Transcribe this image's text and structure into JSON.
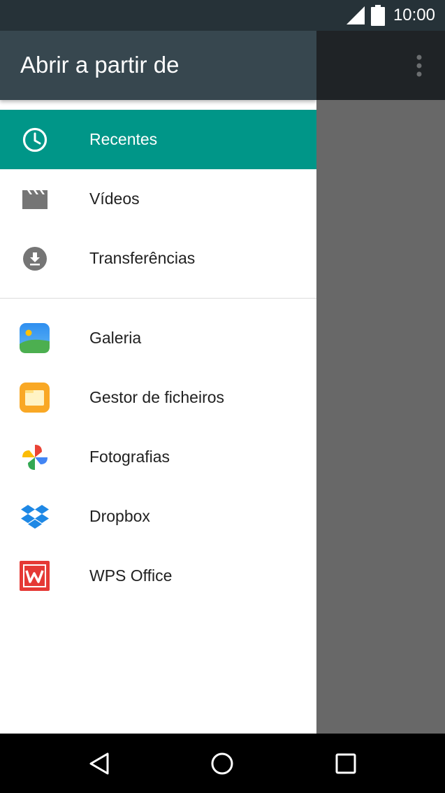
{
  "status_bar": {
    "time": "10:00",
    "icons": [
      "signal-icon",
      "battery-icon"
    ]
  },
  "drawer": {
    "title": "Abrir a partir de",
    "roots": [
      {
        "label": "Recentes",
        "icon": "clock-icon",
        "selected": true
      },
      {
        "label": "Vídeos",
        "icon": "video-icon",
        "selected": false
      },
      {
        "label": "Transferências",
        "icon": "download-icon",
        "selected": false
      }
    ],
    "apps": [
      {
        "label": "Galeria",
        "icon": "gallery-icon"
      },
      {
        "label": "Gestor de ficheiros",
        "icon": "file-manager-icon"
      },
      {
        "label": "Fotografias",
        "icon": "photos-pinwheel-icon"
      },
      {
        "label": "Dropbox",
        "icon": "dropbox-icon"
      },
      {
        "label": "WPS Office",
        "icon": "wps-office-icon"
      }
    ]
  },
  "toolbar": {
    "overflow_icon": "more-vert-icon"
  },
  "nav_bar": {
    "icons": [
      "back-icon",
      "home-icon",
      "recents-icon"
    ]
  },
  "colors": {
    "status_bar": "#263238",
    "drawer_header": "#37474f",
    "selected_item": "#009688",
    "scrim": "#686868"
  }
}
